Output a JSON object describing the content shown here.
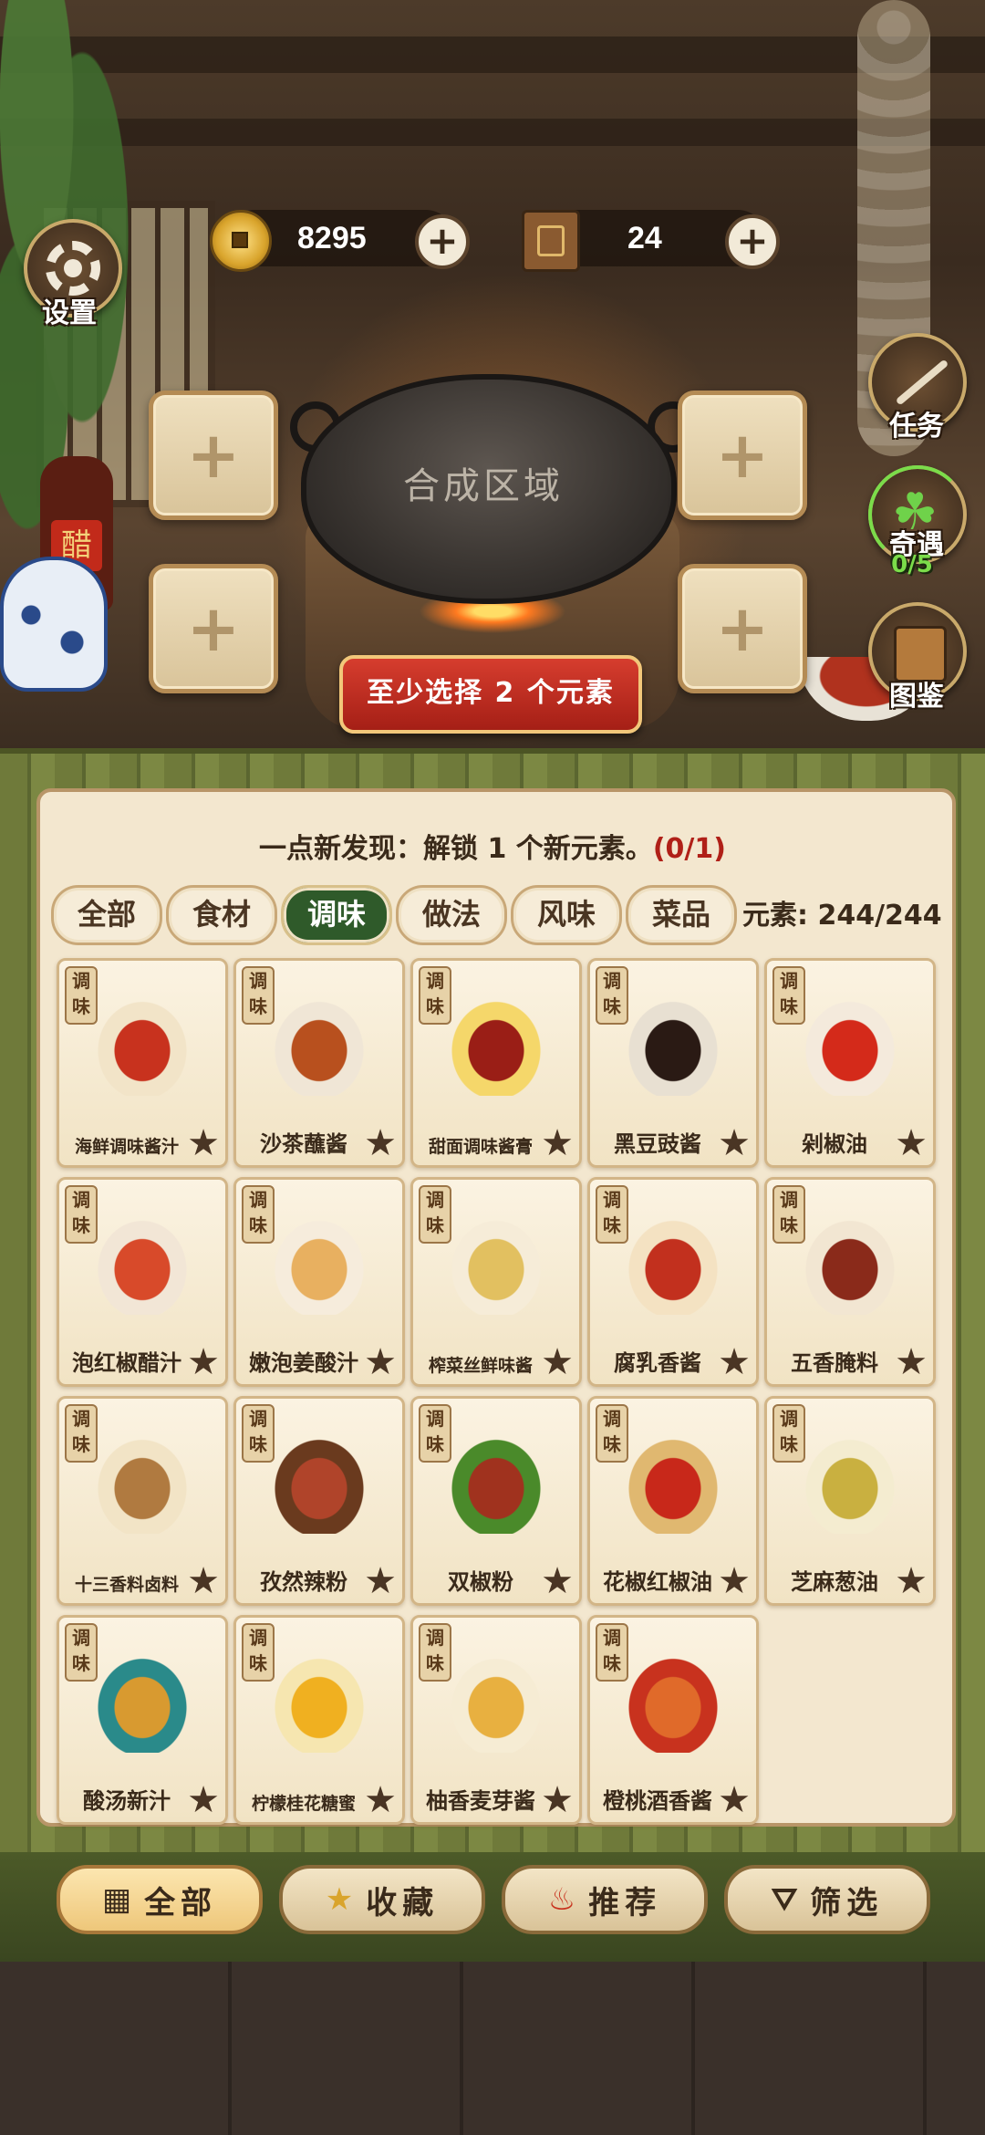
{
  "resources": {
    "coins": "8295",
    "books": "24",
    "coin_plus": "+",
    "book_plus": "+"
  },
  "side_buttons": {
    "settings": "设置",
    "tasks": "任务",
    "encounter": "奇遇",
    "encounter_progress": "0/5",
    "encyclopedia": "图鉴"
  },
  "scene": {
    "wok_label": "合成区域",
    "bottle_label": "醋",
    "slot_plus": "+",
    "hint_button": "至少选择 2 个元素"
  },
  "panel": {
    "quest_text": "一点新发现：解锁 1 个新元素。",
    "quest_count": "(0/1)",
    "tabs": [
      "全部",
      "食材",
      "调味",
      "做法",
      "风味",
      "菜品"
    ],
    "active_tab": "调味",
    "element_count": "元素: 244/244",
    "card_tag": "调味",
    "items": [
      {
        "name": "海鲜调味酱汁",
        "icon": "seafood-sauce-icon"
      },
      {
        "name": "沙茶蘸酱",
        "icon": "satay-sauce-icon"
      },
      {
        "name": "甜面调味酱膏",
        "icon": "sweet-bean-paste-icon"
      },
      {
        "name": "黑豆豉酱",
        "icon": "black-bean-sauce-icon"
      },
      {
        "name": "剁椒油",
        "icon": "chopped-chili-oil-icon"
      },
      {
        "name": "泡红椒醋汁",
        "icon": "pickled-pepper-vinegar-icon"
      },
      {
        "name": "嫩泡姜酸汁",
        "icon": "pickled-ginger-icon"
      },
      {
        "name": "榨菜丝鲜味酱",
        "icon": "zhacai-sauce-icon"
      },
      {
        "name": "腐乳香酱",
        "icon": "fermented-tofu-icon"
      },
      {
        "name": "五香腌料",
        "icon": "five-spice-marinade-icon"
      },
      {
        "name": "十三香料卤料",
        "icon": "thirteen-spice-icon"
      },
      {
        "name": "孜然辣粉",
        "icon": "cumin-chili-powder-icon"
      },
      {
        "name": "双椒粉",
        "icon": "double-pepper-powder-icon"
      },
      {
        "name": "花椒红椒油",
        "icon": "sichuan-pepper-oil-icon"
      },
      {
        "name": "芝麻葱油",
        "icon": "sesame-scallion-oil-icon"
      },
      {
        "name": "酸汤新汁",
        "icon": "sour-soup-icon"
      },
      {
        "name": "柠檬桂花糖蜜",
        "icon": "lemon-osmanthus-syrup-icon"
      },
      {
        "name": "柚香麦芽酱",
        "icon": "pomelo-malt-sauce-icon"
      },
      {
        "name": "橙桃酒香酱",
        "icon": "orange-peach-wine-sauce-icon"
      }
    ]
  },
  "bottom_nav": [
    {
      "label": "全部",
      "icon": "grid-icon"
    },
    {
      "label": "收藏",
      "icon": "star-icon"
    },
    {
      "label": "推荐",
      "icon": "fire-icon"
    },
    {
      "label": "筛选",
      "icon": "filter-icon"
    }
  ],
  "colors": {
    "active_tab": "#2f5a2a",
    "hint_button": "#c52e22",
    "quest_count": "#b02018",
    "encounter_progress": "#7bdc4a"
  }
}
